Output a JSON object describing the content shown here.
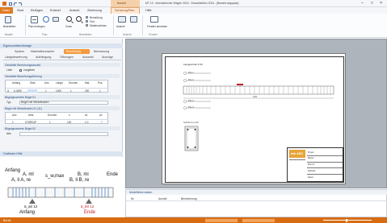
{
  "window": {
    "title": "MT 13 - Wormsbecher Wagen 2024 - Kesselstellen 2024 - [Bewehrungsplan]",
    "controls": [
      "–",
      "□",
      "×"
    ]
  },
  "ribbon": {
    "file_tab": "Datei",
    "tabs": [
      "Start",
      "Einfügen",
      "Entwurf",
      "Ansicht",
      "Zeichnung",
      "Hilfe"
    ],
    "contextual_header": "Bauteil",
    "contextual_tab": "Schalung/Plan",
    "groups": [
      "Bauteil",
      "Plan",
      "Bearbeiten",
      "Ansicht",
      "Fenster"
    ],
    "buttons": [
      "Bearbeiten",
      "Plan erzeugen",
      "Plan aktualisieren",
      "Drucken",
      "Ansicht",
      "Zoom",
      "Stabanschluss",
      "Bemaßung",
      "Text",
      "Fenster anordnen"
    ]
  },
  "left_panel": {
    "title": "Eigenschaften/Anlage",
    "tabs_row1": [
      "System",
      "Materialkennwerte",
      "Bewehrung",
      "Bemessung"
    ],
    "tabs_row2": [
      "Längsbewehrung",
      "Aufhängung",
      "Öffnungen",
      "Auswahl",
      "Auszüge"
    ],
    "section1": "Gewählte Bewehrungsanzahl",
    "field1_label": "Liste",
    "field1_value": "vorgeben",
    "section2": "Gewählte Bewehrungsführung",
    "table_headers": [
      "Anfang",
      "Stab",
      "Anz.",
      "Länge",
      "Durchm.",
      "Mat.",
      "Pos."
    ],
    "table_row": [
      "A",
      "A III/90",
      "1",
      "1000",
      "1",
      "200",
      "1"
    ],
    "section3": "Bügelgeometrie Bügel 01",
    "field3_label": "Typ",
    "field3_value": "Bügel mit Winkelhaken",
    "section4": "Bügel mit Winkelhaken 01 (11)",
    "table2_headers": [
      "Anz.",
      "Abst.",
      "Durchm.",
      "s",
      "a1",
      "a2"
    ],
    "table2_row": [
      "1",
      "STIRRUP",
      "1",
      "100",
      "1.0",
      "?"
    ],
    "section5": "Bügelgeometrie Bügel 02",
    "field5_label": "Abs",
    "field5_value": "",
    "preview_title": "Grafische Hilfe"
  },
  "help_diagram": {
    "start": "Anfang",
    "a_ml": "A, ml",
    "a_li_re": "A, li   A, re",
    "s_wmax": "s_w,max",
    "b_mi": "B, mi",
    "b_li_re": "B, li   B, re",
    "end": "Ende",
    "start_bottom": "Anfang",
    "end_bottom": "Ende",
    "a_bottom": "ä_a0 12",
    "b_bottom": "ä_b0 12"
  },
  "drawing": {
    "sheet_title": "Längsschnitt 1:50",
    "pos_labels": [
      "Pos 1",
      "Pos 2",
      "Pos 3",
      "Pos 4"
    ],
    "dim_label": "5,00",
    "section_label": "Schnitt A-A 1:20",
    "logo_text": "mb AEC",
    "title_block": [
      "Projekt",
      "Bauteil",
      "Plan-Nr.",
      "Maßstab",
      "Datum"
    ]
  },
  "bottom_panel": {
    "title": "Modellinformation",
    "cols": [
      "Nr.",
      "Anzahl",
      "Bezeichnung"
    ]
  },
  "statusbar": {
    "left": "",
    "items": [
      "Bereit",
      "",
      ""
    ]
  },
  "colors": {
    "accent": "#f28c28",
    "ribbon_bg": "#f4f6f9",
    "panel_header": "#dbe5f1",
    "sheet_bg": "#ffffff",
    "canvas_bg": "#aeb4bb",
    "status_bg": "#d76c12"
  }
}
